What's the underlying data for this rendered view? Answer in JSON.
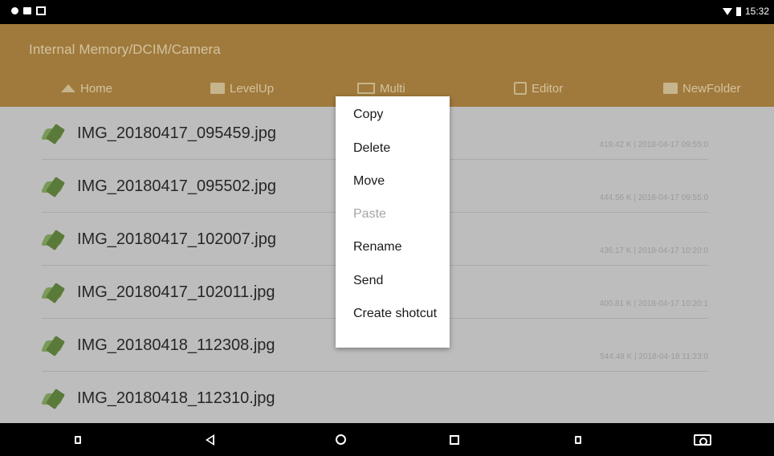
{
  "status_bar": {
    "time": "15:32",
    "left_icons": [
      "circle-notification-icon",
      "square-notification-icon",
      "image-notification-icon"
    ],
    "right_icons": [
      "wifi-icon",
      "battery-icon"
    ]
  },
  "header": {
    "path": "Internal Memory/DCIM/Camera",
    "background_color": "#a07a3c"
  },
  "toolbar": {
    "home": "Home",
    "levelup": "LevelUp",
    "multi": "Multi",
    "editor": "Editor",
    "newfolder": "NewFolder"
  },
  "files": [
    {
      "name": "IMG_20180417_095459.jpg",
      "meta": "419.42 K | 2018-04-17 09:55:0"
    },
    {
      "name": "IMG_20180417_095502.jpg",
      "meta": "444.56 K | 2018-04-17 09:55:0"
    },
    {
      "name": "IMG_20180417_102007.jpg",
      "meta": "436.17 K | 2018-04-17 10:20:0"
    },
    {
      "name": "IMG_20180417_102011.jpg",
      "meta": "400.81 K | 2018-04-17 10:20:1"
    },
    {
      "name": "IMG_20180418_112308.jpg",
      "meta": "544.48 K | 2018-04-18 11:23:0"
    },
    {
      "name": "IMG_20180418_112310.jpg",
      "meta": ""
    }
  ],
  "context_menu": {
    "copy": "Copy",
    "delete": "Delete",
    "move": "Move",
    "paste": "Paste",
    "rename": "Rename",
    "send": "Send",
    "create_shortcut": "Create shotcut"
  },
  "nav_bar": {
    "icons": [
      "volume-down-icon",
      "back-icon",
      "home-icon",
      "recents-icon",
      "volume-up-icon",
      "screenshot-icon"
    ]
  }
}
